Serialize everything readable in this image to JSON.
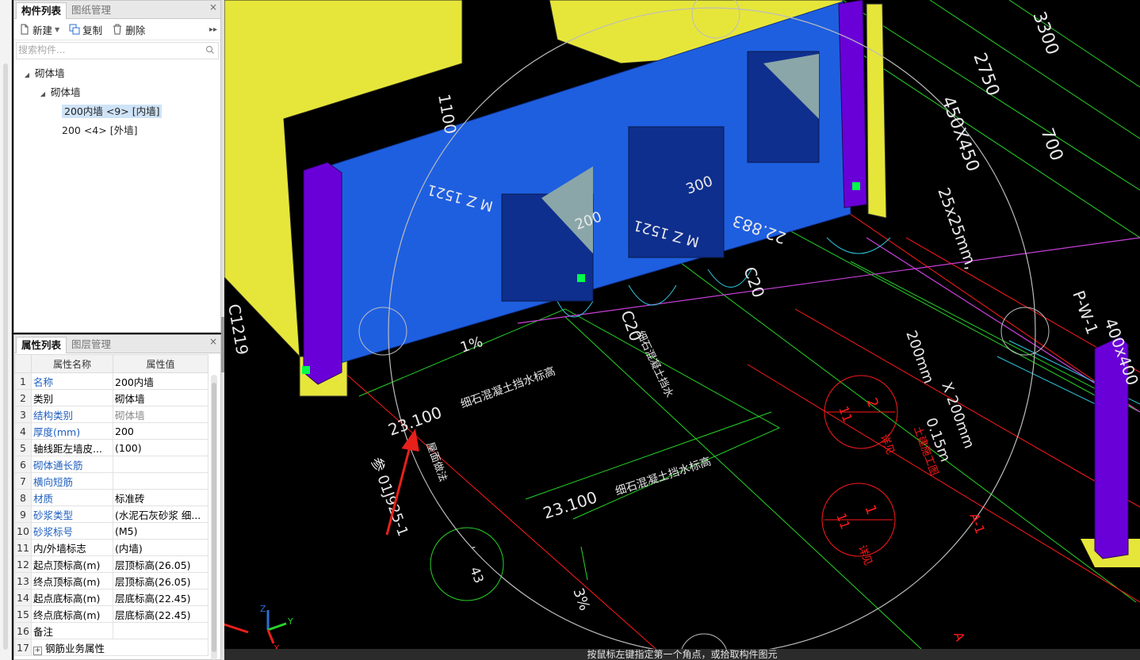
{
  "component_panel": {
    "tabs": [
      "构件列表",
      "图纸管理"
    ],
    "close": "×",
    "toolbar": {
      "new": "新建",
      "copy": "复制",
      "delete": "删除",
      "more": "▸▸"
    },
    "search_placeholder": "搜索构件...",
    "tree": {
      "root": "砌体墙",
      "child": "砌体墙",
      "items": [
        "200内墙 <9> [内墙]",
        "200 <4> [外墙]"
      ]
    }
  },
  "property_panel": {
    "tabs": [
      "属性列表",
      "图层管理"
    ],
    "close": "×",
    "headers": [
      "属性名称",
      "属性值"
    ],
    "rows": [
      {
        "n": "1",
        "name": "名称",
        "value": "200内墙"
      },
      {
        "n": "2",
        "name": "类别",
        "value": "砌体墙"
      },
      {
        "n": "3",
        "name": "结构类别",
        "value": "砌体墙"
      },
      {
        "n": "4",
        "name": "厚度(mm)",
        "value": "200"
      },
      {
        "n": "5",
        "name": "轴线距左墙皮...",
        "value": "(100)"
      },
      {
        "n": "6",
        "name": "砌体通长筋",
        "value": ""
      },
      {
        "n": "7",
        "name": "横向短筋",
        "value": ""
      },
      {
        "n": "8",
        "name": "材质",
        "value": "标准砖"
      },
      {
        "n": "9",
        "name": "砂浆类型",
        "value": "(水泥石灰砂浆 细..."
      },
      {
        "n": "10",
        "name": "砂浆标号",
        "value": "(M5)"
      },
      {
        "n": "11",
        "name": "内/外墙标志",
        "value": "(内墙)"
      },
      {
        "n": "12",
        "name": "起点顶标高(m)",
        "value": "层顶标高(26.05)"
      },
      {
        "n": "13",
        "name": "终点顶标高(m)",
        "value": "层顶标高(26.05)"
      },
      {
        "n": "14",
        "name": "起点底标高(m)",
        "value": "层底标高(22.45)"
      },
      {
        "n": "15",
        "name": "终点底标高(m)",
        "value": "层底标高(22.45)"
      },
      {
        "n": "16",
        "name": "备注",
        "value": ""
      },
      {
        "n": "17",
        "name": "钢筋业务属性",
        "value": ""
      }
    ],
    "expander": "+"
  },
  "viewport": {
    "labels": {
      "dim_1100": "1100",
      "dim_2750": "2750",
      "dim_3300": "3300",
      "dim_700": "700",
      "sec_450": "450X450",
      "slope_25": "25x25mm,",
      "elev_22883": "22.883",
      "slope_1": "1%",
      "slope_3": "3%",
      "grade_c20a": "C20",
      "grade_c20b": "C20",
      "c1219": "C1219",
      "p_w_1": "P-W-1",
      "sec_400": "400x400",
      "elev_a": "23.100",
      "elev_b": "23.100",
      "note_a": "细石混凝土挡水标高",
      "note_b": "细石混凝土挡水标高",
      "note_c": "细石混凝土挡水",
      "size_200": "200mm",
      "size_200b": "X 200mm",
      "thk": "0.15m",
      "ref_99": "参 01J925-1",
      "ref_pm": "屋面做法",
      "circ_1": "1",
      "circ_2": "2",
      "circ_11a": "11",
      "circ_11b": "11",
      "circ_43": "43",
      "circ_dash": "-",
      "red_a": "详见",
      "red_b": "详见",
      "red_c": "土建施工图",
      "axis_a": "A",
      "axis_a1": "A-1",
      "axis_x": "X",
      "axis_y": "Y",
      "axis_z": "Z",
      "wm_a": "M Z 1521",
      "wm_b": "M Z 1521",
      "wm_300": "300",
      "wm_200": "200"
    },
    "status": "按鼠标左键指定第一个角点，或拾取构件图元",
    "colors": {
      "wall_blue": "#1e5fe0",
      "column_purple": "#6a00d8",
      "slab_yellow": "#e6e63a",
      "annot_green": "#27d327",
      "annot_red": "#ff1a1a",
      "annot_white": "#e8e8e8",
      "arrow_red": "#e8201a"
    }
  }
}
